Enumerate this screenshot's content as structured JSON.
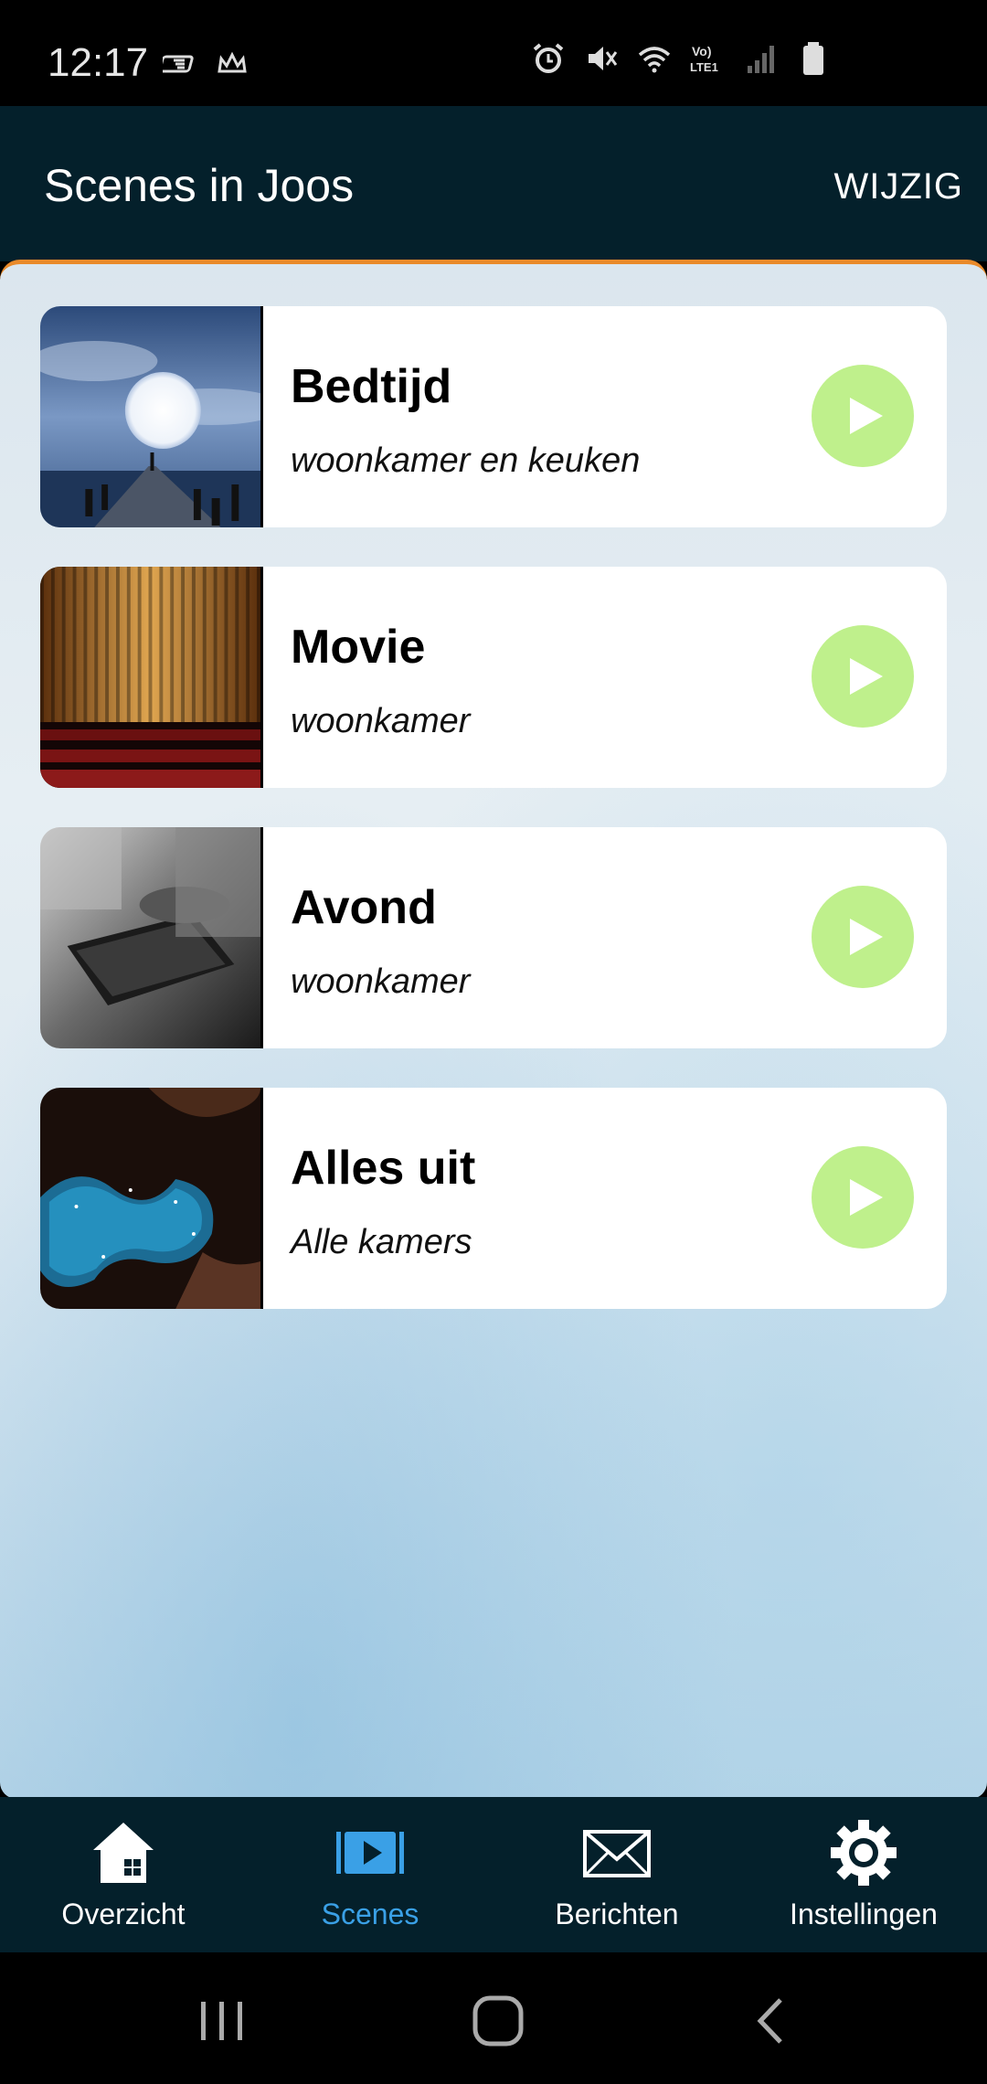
{
  "status_bar": {
    "time": "12:17",
    "icons": [
      "app-icon-1",
      "app-icon-2",
      "alarm-icon",
      "mute-icon",
      "wifi-icon",
      "volte-icon",
      "signal-icon",
      "battery-icon"
    ]
  },
  "header": {
    "title": "Scenes in Joos",
    "edit_label": "WIJZIG"
  },
  "colors": {
    "header_bg": "#04202b",
    "accent_line": "#e98a2a",
    "play_button": "#bff08c",
    "active_tab": "#3aa0e6"
  },
  "scenes": [
    {
      "name": "Bedtijd",
      "rooms": "woonkamer en keuken",
      "image": "moon-pier-image"
    },
    {
      "name": "Movie",
      "rooms": "woonkamer",
      "image": "theater-curtain-image"
    },
    {
      "name": "Avond",
      "rooms": "woonkamer",
      "image": "book-reading-image"
    },
    {
      "name": "Alles uit",
      "rooms": "Alle kamers",
      "image": "starry-canyon-image"
    }
  ],
  "bottom_nav": [
    {
      "label": "Overzicht",
      "icon": "home-icon",
      "active": false
    },
    {
      "label": "Scenes",
      "icon": "scenes-icon",
      "active": true
    },
    {
      "label": "Berichten",
      "icon": "envelope-icon",
      "active": false
    },
    {
      "label": "Instellingen",
      "icon": "gear-icon",
      "active": false
    }
  ]
}
